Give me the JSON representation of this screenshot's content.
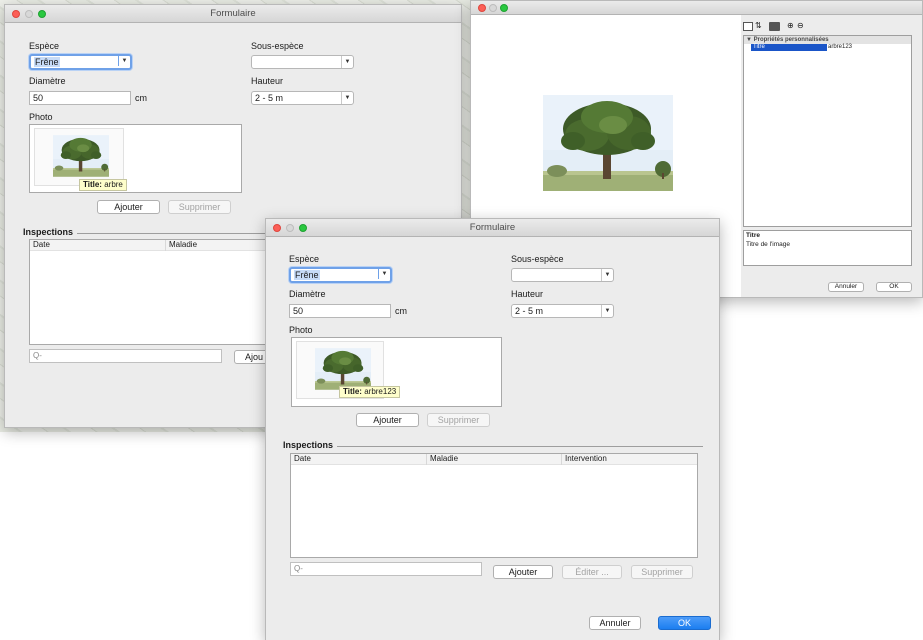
{
  "back_form": {
    "title": "Formulaire",
    "espece_label": "Espèce",
    "espece_value": "Frêne",
    "sous_espece_label": "Sous-espèce",
    "sous_espece_value": "",
    "diametre_label": "Diamètre",
    "diametre_value": "50",
    "unit": "cm",
    "hauteur_label": "Hauteur",
    "hauteur_value": "2 - 5 m",
    "photo_label": "Photo",
    "tooltip_key": "Title:",
    "tooltip_value": "arbre",
    "ajouter": "Ajouter",
    "supprimer": "Supprimer",
    "inspections_label": "Inspections",
    "col_date": "Date",
    "col_maladie": "Maladie",
    "ajouter2": "Ajou"
  },
  "props_window": {
    "section": "▼ Propriétés personnalisées",
    "prop_name": "Titre",
    "prop_value": "arbre123",
    "desc_title": "Titre",
    "desc_text": "Titre de l'image",
    "annuler": "Annuler",
    "ok": "OK"
  },
  "front_form": {
    "title": "Formulaire",
    "espece_label": "Espèce",
    "espece_value": "Frêne",
    "sous_espece_label": "Sous-espèce",
    "sous_espece_value": "",
    "diametre_label": "Diamètre",
    "diametre_value": "50",
    "unit": "cm",
    "hauteur_label": "Hauteur",
    "hauteur_value": "2 - 5 m",
    "photo_label": "Photo",
    "tooltip_key": "Title:",
    "tooltip_value": "arbre123",
    "ajouter": "Ajouter",
    "supprimer": "Supprimer",
    "inspections_label": "Inspections",
    "col_date": "Date",
    "col_maladie": "Maladie",
    "col_intervention": "Intervention",
    "search_placeholder": "Q-",
    "ajouter_inspection": "Ajouter",
    "editer": "Éditer ...",
    "supprimer_inspection": "Supprimer",
    "annuler": "Annuler",
    "ok": "OK"
  },
  "colors": {
    "accent": "#1c7ef0",
    "focus": "#6fa1e8",
    "selection": "#1a55c8",
    "tooltip": "#fefecb"
  }
}
